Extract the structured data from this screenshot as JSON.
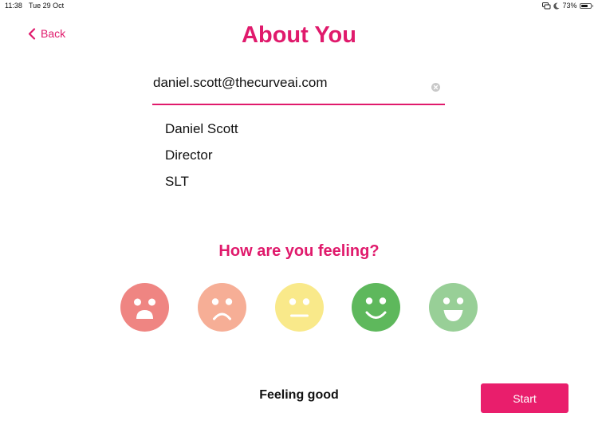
{
  "status_bar": {
    "time": "11:38",
    "date": "Tue 29 Oct",
    "battery_percent": "73%",
    "battery_level": 0.73,
    "icons": [
      "screen-mirroring-icon",
      "do-not-disturb-moon-icon",
      "battery-icon"
    ]
  },
  "header": {
    "back_label": "Back",
    "title": "About You"
  },
  "email_field": {
    "value": "daniel.scott@thecurveai.com",
    "clear_icon": "clear-circle-x-icon"
  },
  "profile": {
    "name": "Daniel Scott",
    "role": "Director",
    "team": "SLT"
  },
  "feeling": {
    "question": "How are you feeling?",
    "faces": [
      {
        "mood": "very-unhappy",
        "color": "#ef8582"
      },
      {
        "mood": "unhappy",
        "color": "#f6ae96"
      },
      {
        "mood": "neutral",
        "color": "#f9e98a"
      },
      {
        "mood": "happy",
        "color": "#5eb85c"
      },
      {
        "mood": "very-happy",
        "color": "#98cf97"
      }
    ],
    "selected_label": "Feeling good"
  },
  "actions": {
    "start_label": "Start"
  },
  "colors": {
    "accent": "#e01a6c",
    "button": "#e91e6c"
  }
}
